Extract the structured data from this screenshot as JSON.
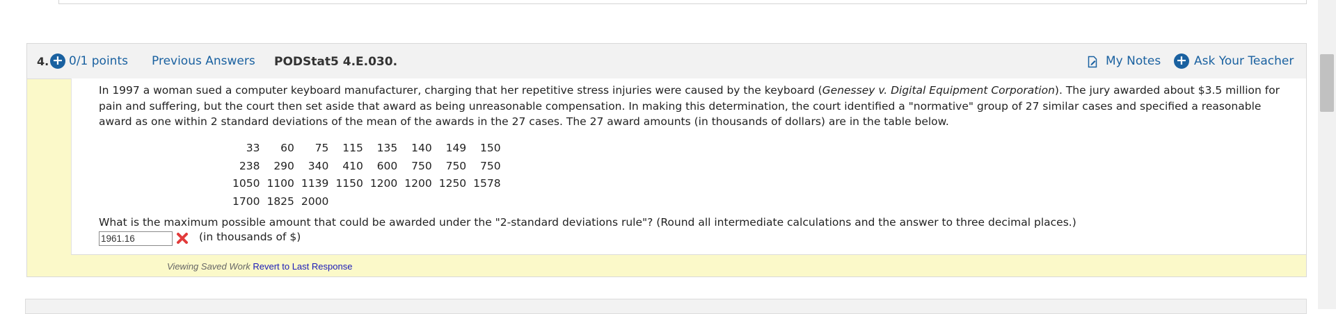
{
  "question": {
    "number": "4.",
    "points": "0/1 points",
    "previous_answers": "Previous Answers",
    "code": "PODStat5 4.E.030.",
    "my_notes": "My Notes",
    "ask_teacher": "Ask Your Teacher",
    "prompt": {
      "part1": "In 1997 a woman sued a computer keyboard manufacturer, charging that her repetitive stress injuries were caused by the keyboard (",
      "case_name": "Genessey v. Digital Equipment Corporation",
      "part2": "). The jury awarded about $3.5 million for pain and suffering, but the court then set aside that award as being unreasonable compensation. In making this determination, the court identified a \"normative\" group of 27 similar cases and specified a reasonable award as one within 2 standard deviations of the mean of the awards in the 27 cases. The 27 award amounts (in thousands of dollars) are in the table below."
    },
    "award_rows": [
      [
        "33",
        "60",
        "75",
        "115",
        "135",
        "140",
        "149",
        "150"
      ],
      [
        "238",
        "290",
        "340",
        "410",
        "600",
        "750",
        "750",
        "750"
      ],
      [
        "1050",
        "1100",
        "1139",
        "1150",
        "1200",
        "1200",
        "1250",
        "1578"
      ],
      [
        "1700",
        "1825",
        "2000",
        "",
        "",
        "",
        "",
        ""
      ]
    ],
    "question_text": "What is the maximum possible amount that could be awarded under the \"2-standard deviations rule\"? (Round all intermediate calculations and the answer to three decimal places.)",
    "answer_value": "1961.16",
    "unit": "(in thousands of $)",
    "saved_note": "Viewing Saved Work",
    "revert_link": "Revert to Last Response"
  },
  "colors": {
    "accent": "#1a61a0",
    "wrong": "#e23b3b",
    "pale_yellow": "#fbf9c9",
    "header_bg": "#f2f2f2"
  },
  "icons": {
    "points": "plus-circle-icon",
    "notes": "notes-icon",
    "ask": "plus-circle-icon",
    "result": "incorrect-x-icon"
  }
}
